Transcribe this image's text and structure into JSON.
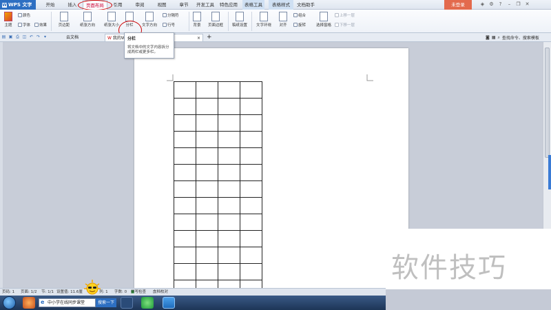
{
  "app": {
    "logo_text": "WPS 文字"
  },
  "menu_tabs": [
    {
      "label": "开始"
    },
    {
      "label": "插入"
    },
    {
      "label": "页面布局"
    },
    {
      "label": "引用"
    },
    {
      "label": "审阅"
    },
    {
      "label": "视图"
    },
    {
      "label": "章节"
    },
    {
      "label": "开发工具"
    },
    {
      "label": "特色应用"
    },
    {
      "label": "表格工具"
    },
    {
      "label": "表格样式"
    },
    {
      "label": "文档助手"
    }
  ],
  "header": {
    "login_label": "未登录"
  },
  "ribbon": {
    "theme": "主题",
    "color": "颜色",
    "font": "字体",
    "effect": "效果",
    "margins": "页边距",
    "orientation": "纸张方向",
    "paper_size": "纸张大小",
    "columns": "分栏",
    "text_direction": "文字方向",
    "line_numbers": "行号",
    "breaks": "分隔符",
    "background": "背景",
    "page_border": "页面边框",
    "draft": "稿纸设置",
    "wrap_text": "文字环绕",
    "align": "对齐",
    "rotate": "旋转",
    "group": "组合",
    "select_pane": "选择窗格",
    "bring_forward": "上移一层",
    "send_backward": "下移一层"
  },
  "doc_tabs": [
    {
      "label": "云文档"
    },
    {
      "label": "我的WPS"
    }
  ],
  "command_search": "查找命令、搜索模板",
  "tooltip": {
    "title": "分栏",
    "desc": "将文档中的文字内容拆分成两栏或更多栏。"
  },
  "table": {
    "rows": 13,
    "cols": 4
  },
  "watermark": "软件技巧",
  "status": {
    "page_num": "页码: 1",
    "pages": "页面: 1/2",
    "section": "节: 1/1",
    "setting": "设置值: 11.6厘",
    "col": "列: 1",
    "words": "字数: 0",
    "spell": "拼写检查",
    "proof": "文档校对"
  },
  "taskbar": {
    "search_text": "中小学在线同步课堂",
    "search_button": "搜索一下"
  }
}
